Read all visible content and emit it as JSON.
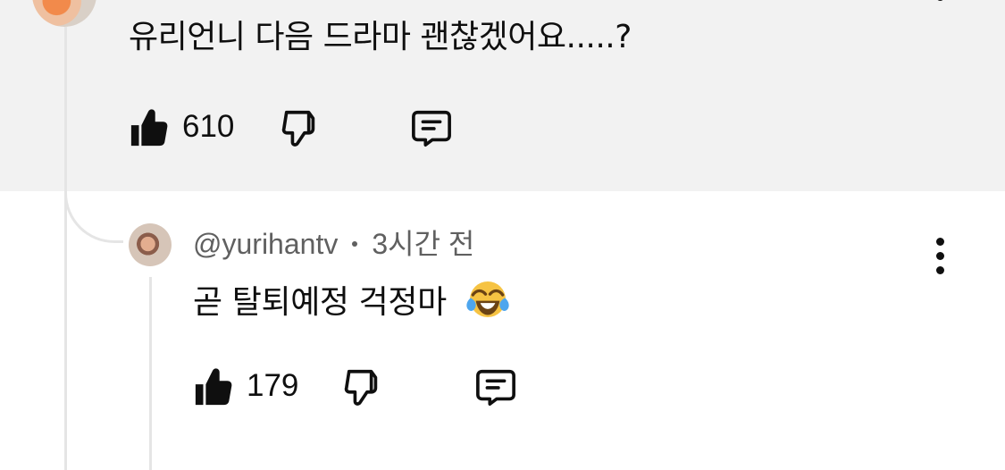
{
  "parent_comment": {
    "text": "유리언니 다음 드라마 괜찮겠어요.....?",
    "likes": "610",
    "more_icon": "more-vertical-icon",
    "like_icon": "thumb-up-filled-icon",
    "dislike_icon": "thumb-down-outline-icon",
    "reply_icon": "comment-bubble-icon"
  },
  "reply_comment": {
    "author": "@yurihantv",
    "time": "3시간 전",
    "text": "곧 탈퇴예정 걱정마",
    "emoji": "face-with-tears-of-joy",
    "likes": "179",
    "more_icon": "more-vertical-icon",
    "like_icon": "thumb-up-filled-icon",
    "dislike_icon": "thumb-down-outline-icon",
    "reply_icon": "comment-bubble-icon"
  },
  "colors": {
    "highlight_background": "#f2f2f2",
    "text": "#0f0f0f",
    "secondary_text": "#606060",
    "thread_line": "#e5e5e5",
    "emoji_yellow": "#f6c343",
    "emoji_tears": "#4ea6ee"
  }
}
